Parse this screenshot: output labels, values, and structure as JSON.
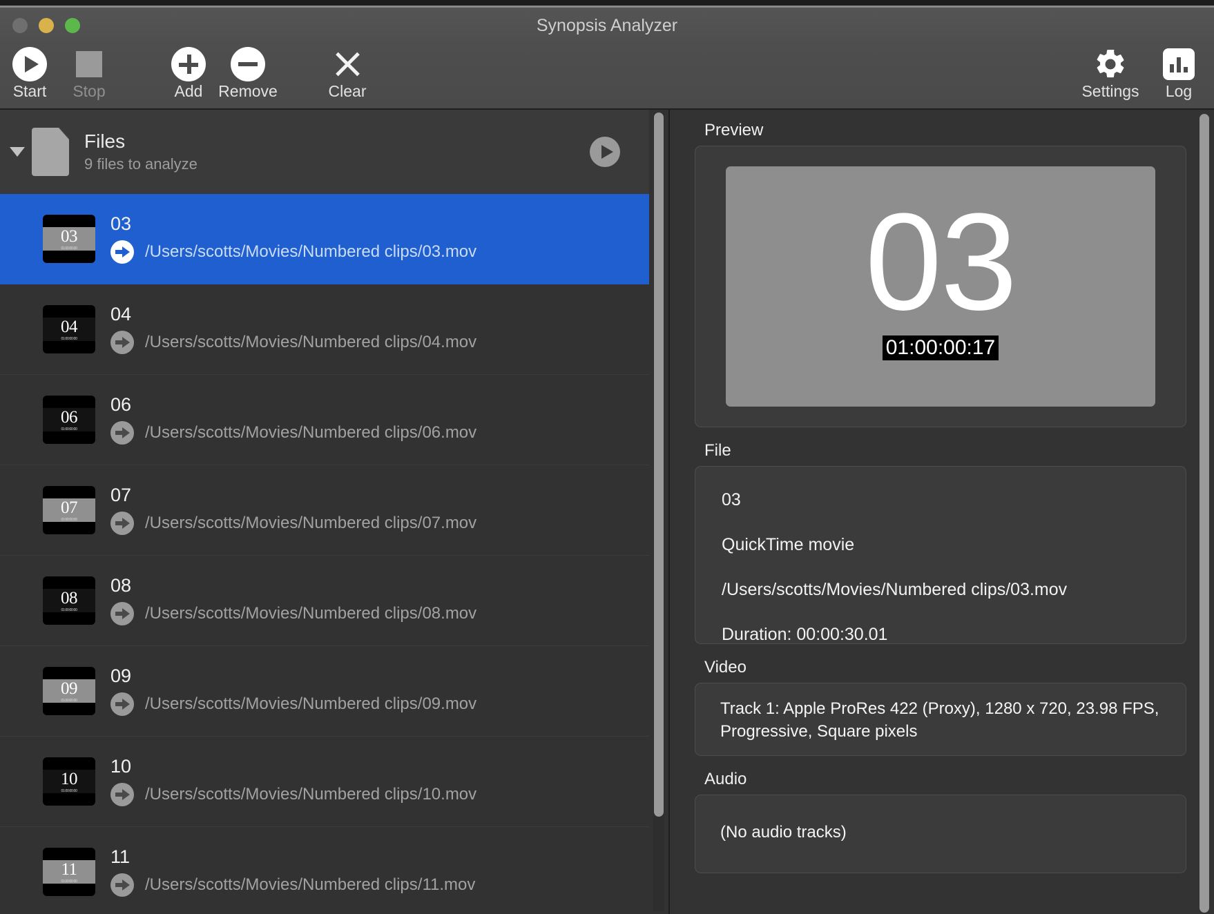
{
  "window": {
    "title": "Synopsis Analyzer",
    "traffic_lights": [
      "close",
      "minimize",
      "maximize"
    ],
    "accent_selection": "#1f5fd0"
  },
  "toolbar": {
    "buttons": [
      {
        "label": "Start",
        "icon": "play-icon",
        "enabled": true
      },
      {
        "label": "Stop",
        "icon": "stop-icon",
        "enabled": false
      },
      {
        "label": "Add",
        "icon": "plus-icon",
        "enabled": true
      },
      {
        "label": "Remove",
        "icon": "minus-icon",
        "enabled": true
      },
      {
        "label": "Clear",
        "icon": "close-icon",
        "enabled": true
      }
    ],
    "right_buttons": [
      {
        "label": "Settings",
        "icon": "gear-icon"
      },
      {
        "label": "Log",
        "icon": "bar-chart-icon"
      }
    ]
  },
  "file_list": {
    "group": {
      "title": "Files",
      "subtitle": "9 files to analyze",
      "disclosure": "expanded",
      "action_icon": "play-icon"
    },
    "rows": [
      {
        "name": "03",
        "path": "/Users/scotts/Movies/Numbered clips/03.mov",
        "thumb_label": "03",
        "thumb_tone": "light",
        "selected": true
      },
      {
        "name": "04",
        "path": "/Users/scotts/Movies/Numbered clips/04.mov",
        "thumb_label": "04",
        "thumb_tone": "dark",
        "selected": false
      },
      {
        "name": "06",
        "path": "/Users/scotts/Movies/Numbered clips/06.mov",
        "thumb_label": "06",
        "thumb_tone": "dark",
        "selected": false
      },
      {
        "name": "07",
        "path": "/Users/scotts/Movies/Numbered clips/07.mov",
        "thumb_label": "07",
        "thumb_tone": "light",
        "selected": false
      },
      {
        "name": "08",
        "path": "/Users/scotts/Movies/Numbered clips/08.mov",
        "thumb_label": "08",
        "thumb_tone": "dark",
        "selected": false
      },
      {
        "name": "09",
        "path": "/Users/scotts/Movies/Numbered clips/09.mov",
        "thumb_label": "09",
        "thumb_tone": "light",
        "selected": false
      },
      {
        "name": "10",
        "path": "/Users/scotts/Movies/Numbered clips/10.mov",
        "thumb_label": "10",
        "thumb_tone": "dark",
        "selected": false
      },
      {
        "name": "11",
        "path": "/Users/scotts/Movies/Numbered clips/11.mov",
        "thumb_label": "11",
        "thumb_tone": "light",
        "selected": false
      }
    ]
  },
  "inspector": {
    "preview": {
      "section_label": "Preview",
      "frame_number": "03",
      "timecode": "01:00:00:17"
    },
    "file": {
      "section_label": "File",
      "name": "03",
      "kind": "QuickTime movie",
      "path": "/Users/scotts/Movies/Numbered clips/03.mov",
      "duration": "Duration: 00:00:30.01"
    },
    "video": {
      "section_label": "Video",
      "track": "Track 1: Apple ProRes 422 (Proxy), 1280 x 720, 23.98 FPS, Progressive, Square pixels"
    },
    "audio": {
      "section_label": "Audio",
      "tracks": "(No audio tracks)"
    }
  }
}
